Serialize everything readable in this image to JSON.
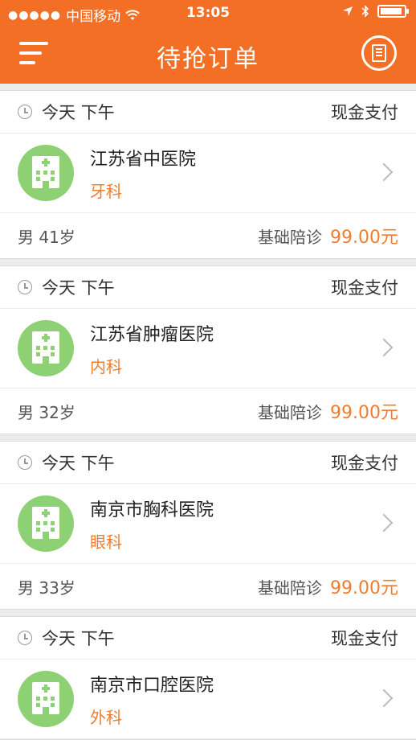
{
  "status_bar": {
    "carrier": "中国移动",
    "time": "13:05"
  },
  "nav": {
    "title": "待抢订单"
  },
  "orders": [
    {
      "day": "今天",
      "period": "下午",
      "payment": "现金支付",
      "hospital": "江苏省中医院",
      "department": "牙科",
      "gender": "男",
      "age": "41岁",
      "service": "基础陪诊",
      "price": "99.00元"
    },
    {
      "day": "今天",
      "period": "下午",
      "payment": "现金支付",
      "hospital": "江苏省肿瘤医院",
      "department": "内科",
      "gender": "男",
      "age": "32岁",
      "service": "基础陪诊",
      "price": "99.00元"
    },
    {
      "day": "今天",
      "period": "下午",
      "payment": "现金支付",
      "hospital": "南京市胸科医院",
      "department": "眼科",
      "gender": "男",
      "age": "33岁",
      "service": "基础陪诊",
      "price": "99.00元"
    },
    {
      "day": "今天",
      "period": "下午",
      "payment": "现金支付",
      "hospital": "南京市口腔医院",
      "department": "外科"
    }
  ]
}
